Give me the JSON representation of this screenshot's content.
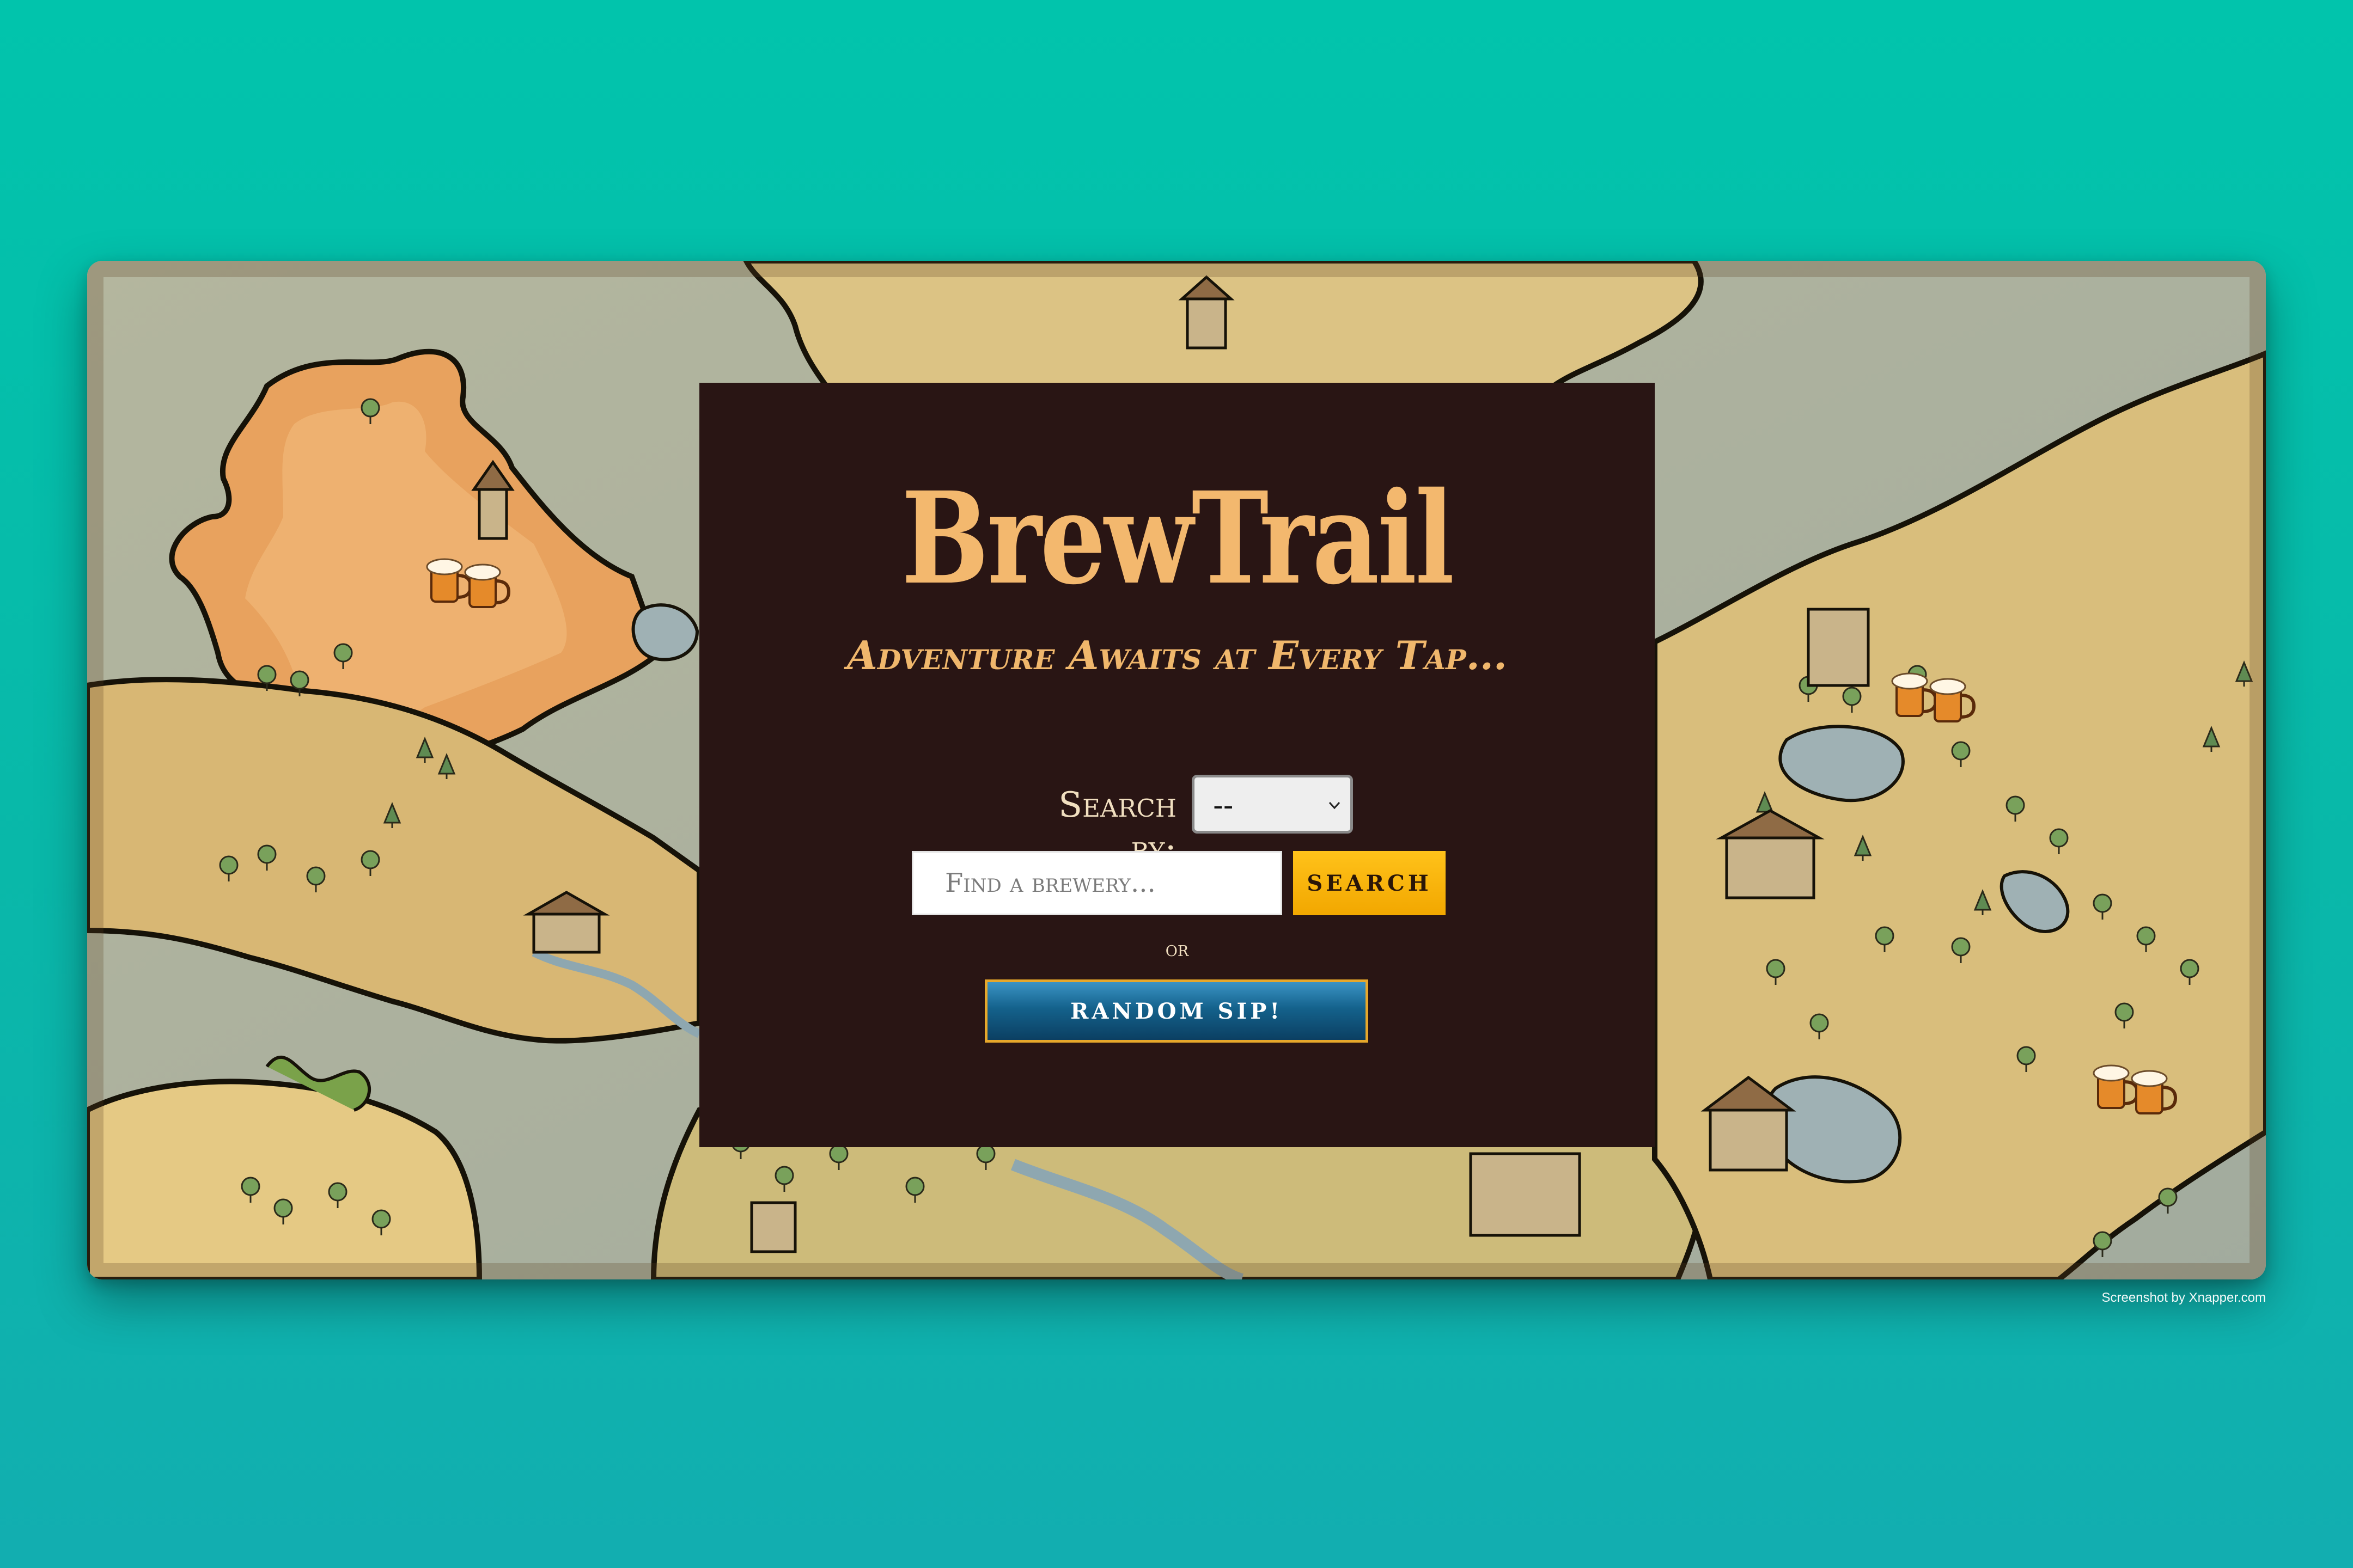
{
  "app": {
    "title": "BrewTrail",
    "tagline": "Adventure Awaits at Every Tap..."
  },
  "search": {
    "search_by_label": "Search by:",
    "search_by_selected": "--",
    "input_placeholder": "Find a brewery...",
    "input_value": "",
    "search_button_label": "Search",
    "or_label": "or",
    "random_button_label": "Random Sip!"
  },
  "credit": "Screenshot by Xnapper.com",
  "icons": {
    "map_markers": [
      "beer-mugs-icon",
      "beer-mugs-icon",
      "beer-mugs-icon"
    ],
    "select_arrow": "chevron-down-icon"
  },
  "colors": {
    "page_background": "#01c4ac",
    "panel_background": "#291514",
    "title_color": "#f3b86e",
    "search_button": "#ffc21a",
    "random_button": "#14628c",
    "random_button_border": "#e6a72b"
  }
}
